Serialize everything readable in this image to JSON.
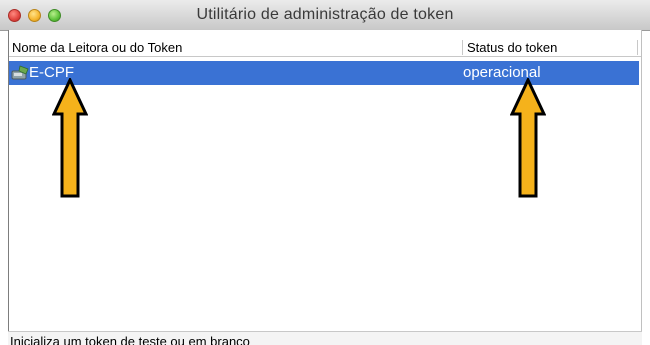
{
  "window": {
    "title": "Utilitário de administração de token"
  },
  "table": {
    "columns": [
      "Nome da Leitora ou do Token",
      "Status do token"
    ],
    "rows": [
      {
        "name": "E-CPF",
        "status": "operacional",
        "icon": "token-reader-icon",
        "selected": true
      }
    ]
  },
  "annotations": {
    "arrow_color": "#f5b21b",
    "arrow_outline": "#000000",
    "arrows": [
      "arrow-up-icon",
      "arrow-up-icon"
    ]
  },
  "statusbar": {
    "text": "Inicializa um token de teste ou em branco"
  },
  "colors": {
    "selection": "#3a72d4"
  }
}
